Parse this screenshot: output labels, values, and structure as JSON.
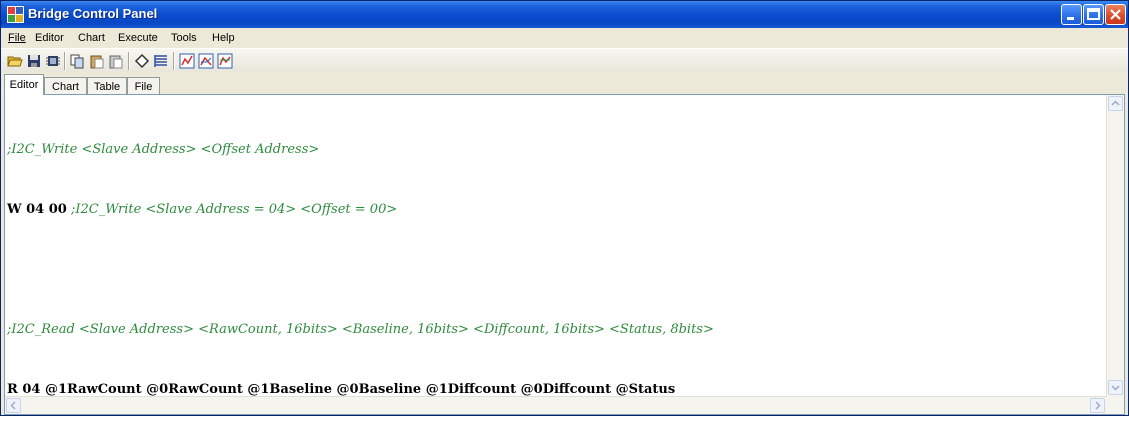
{
  "window": {
    "title": "Bridge Control Panel",
    "controls": [
      "minimize-icon",
      "maximize-icon",
      "close-icon"
    ]
  },
  "menu": {
    "items": [
      {
        "label": "File"
      },
      {
        "label": "Editor"
      },
      {
        "label": "Chart"
      },
      {
        "label": "Execute"
      },
      {
        "label": "Tools"
      },
      {
        "label": "Help"
      }
    ]
  },
  "toolbar": {
    "icons": [
      "open-folder-icon",
      "save-icon",
      "device-icon",
      "copy-icon",
      "paste-icon",
      "paste-alt-icon",
      "clear-icon",
      "list-icon",
      "chart-line-icon",
      "chart-multi-icon",
      "chart-bar-icon"
    ]
  },
  "tabs": [
    {
      "label": "Editor",
      "active": true
    },
    {
      "label": "Chart"
    },
    {
      "label": "Table"
    },
    {
      "label": "File"
    }
  ],
  "editor": {
    "lines": [
      ";I2C_Write <Slave Address> <Offset Address>",
      "W 04 00",
      " ;I2C_Write <Slave Address = 04> <Offset = 00>",
      "",
      ";I2C_Read <Slave Address> <RawCount, 16bits> <Baseline, 16bits> <Diffcount, 16bits> <Status, 8bits>",
      "R 04 @1RawCount @0RawCount @1Baseline @0Baseline @1Diffcount @0Diffcount @Status"
    ]
  },
  "colors": {
    "comment": "#2e8b3d",
    "titlebar": "#0a4ed0"
  }
}
